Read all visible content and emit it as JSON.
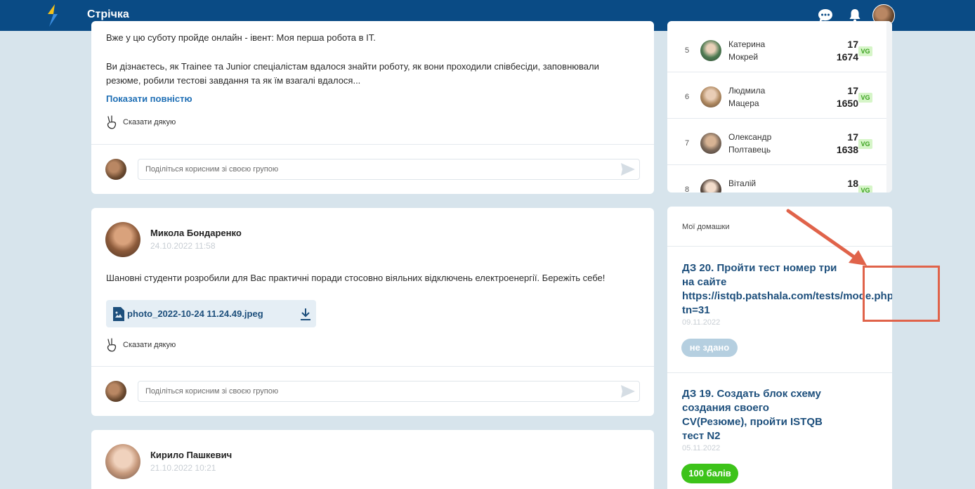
{
  "header": {
    "title": "Стрічка",
    "icons": [
      "chat-icon",
      "bell-icon",
      "user-avatar"
    ],
    "brand_color": "#0a4b85"
  },
  "feed": {
    "post1": {
      "line1": "Вже у цю суботу пройде онлайн - івент: Моя перша робота в IT.",
      "line2": "Ви дізнаєтесь, як Trainee та Junior спеціалістам вдалося знайти роботу, як вони проходили співбесіди, заповнювали",
      "line3": "резюме, робили тестові завдання та як їм взагалі вдалося...",
      "show_more": "Показати повністю",
      "thanks": "Сказати дякую",
      "comment_placeholder": "Поділіться корисним зі своєю групою"
    },
    "post2": {
      "author": "Микола Бондаренко",
      "date": "24.10.2022 11:58",
      "text": "Шановні студенти розробили для Вас практичні поради стосовно віяльних відключень електроенергії. Бережіть себе!",
      "attachment": "photo_2022-10-24 11.24.49.jpeg",
      "thanks": "Сказати дякую",
      "comment_placeholder": "Поділіться корисним зі своєю групою"
    },
    "post3": {
      "author": "Кирило Пашкевич",
      "date": "21.10.2022 10:21"
    }
  },
  "ranking": {
    "rows": [
      {
        "rank": "5",
        "first": "Катерина",
        "last": "Мокрей",
        "level": "17",
        "points": "1674",
        "badge": "VG"
      },
      {
        "rank": "6",
        "first": "Людмила",
        "last": "Мацера",
        "level": "17",
        "points": "1650",
        "badge": "VG"
      },
      {
        "rank": "7",
        "first": "Олександр",
        "last": "Полтавець",
        "level": "17",
        "points": "1638",
        "badge": "VG"
      },
      {
        "rank": "8",
        "first": "Віталій",
        "last": "",
        "level": "18",
        "points": "",
        "badge": "VG"
      }
    ]
  },
  "homework": {
    "header": "Мої домашки",
    "items": [
      {
        "title_lines": [
          "ДЗ 20. Пройти тест номер три",
          "на сайте",
          "https://istqb.patshala.com/tests/mode.php?",
          "tn=31"
        ],
        "date": "09.11.2022",
        "status": "не здано"
      },
      {
        "title_lines": [
          "ДЗ 19. Создать блок схему",
          "создания своего",
          "CV(Резюме), пройти ISTQB",
          "тест N2"
        ],
        "date": "05.11.2022",
        "status": "100 балів"
      }
    ]
  },
  "colors": {
    "link": "#1f6fb5",
    "hw_title": "#1d4f7c",
    "pass": "#3dc31a",
    "not_passed": "#b5cfe0",
    "annotation": "#e0634a"
  }
}
